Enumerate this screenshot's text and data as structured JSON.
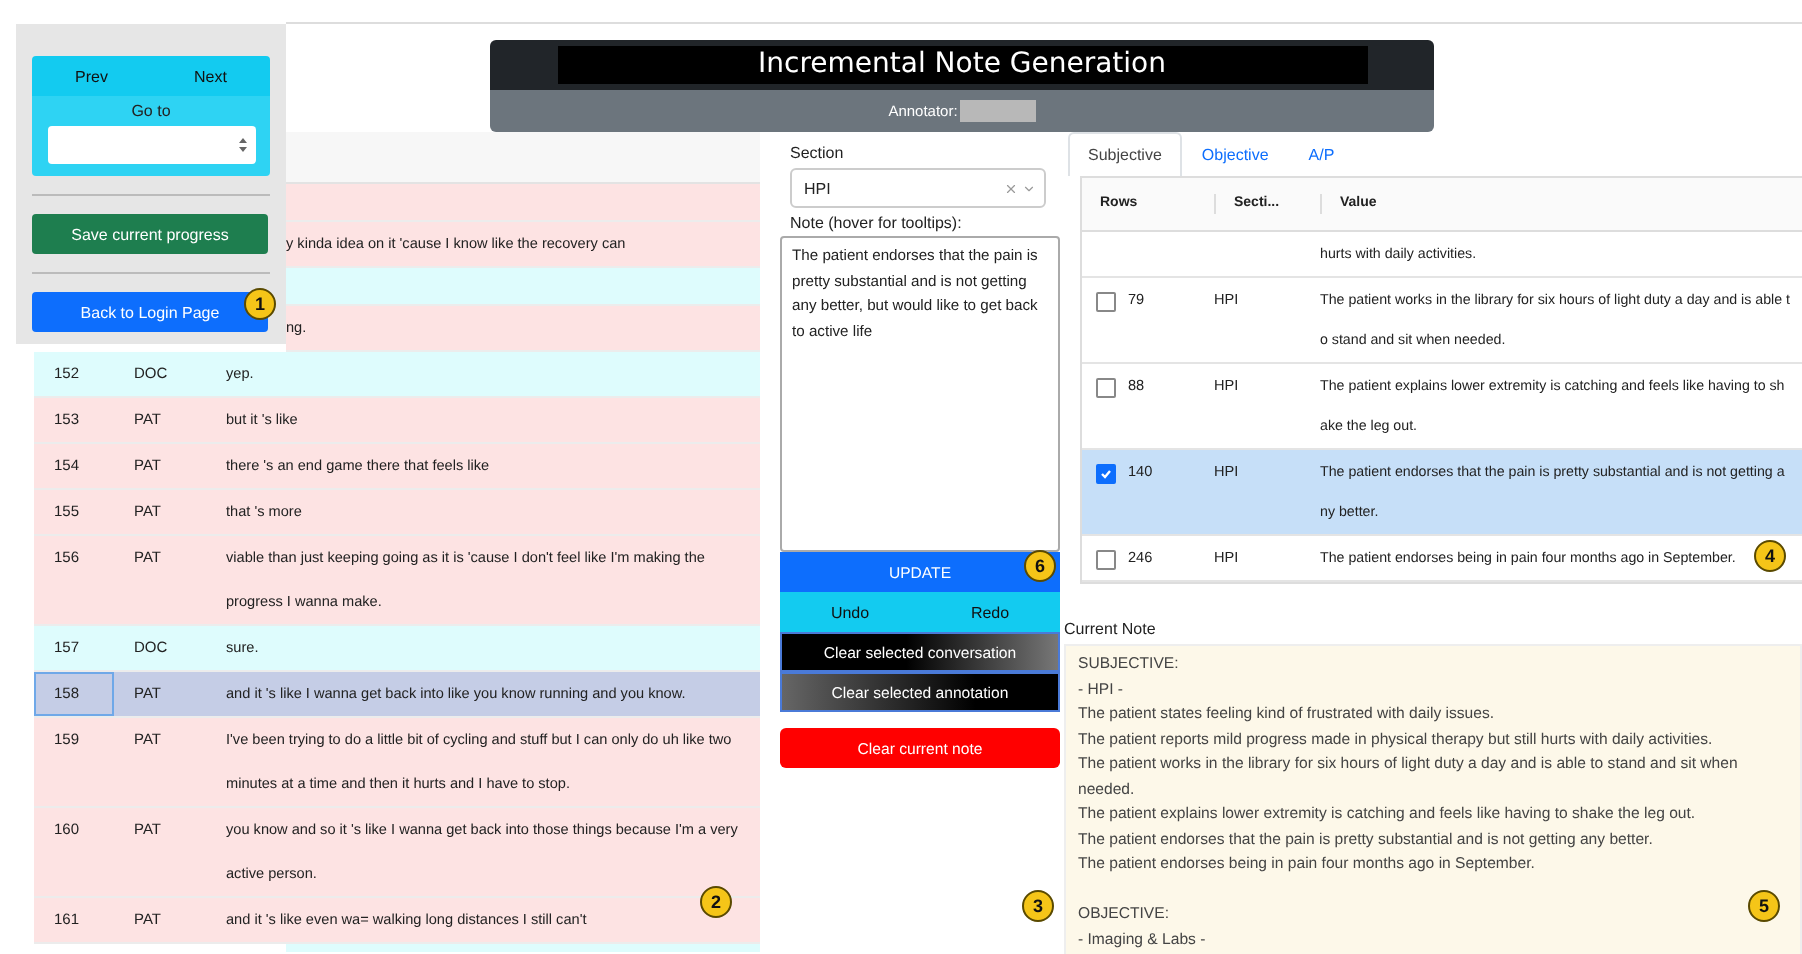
{
  "header": {
    "title": "Incremental Note Generation",
    "annotator_label": "Annotator:"
  },
  "nav_panel": {
    "prev": "Prev",
    "next": "Next",
    "goto_label": "Go to",
    "save": "Save current progress",
    "back": "Back to Login Page"
  },
  "conversation": {
    "rows": [
      {
        "kind": "pat",
        "selected": false
      },
      {
        "kind": "pat",
        "selected": false,
        "text": "y kinda idea on it 'cause I know like the recovery can"
      },
      {
        "kind": "doc",
        "selected": false
      },
      {
        "kind": "pat",
        "selected": false,
        "text": "ng."
      },
      {
        "kind": "doc",
        "selected": false,
        "num": "152",
        "speaker": "DOC",
        "text": "yep."
      },
      {
        "kind": "pat",
        "selected": false,
        "num": "153",
        "speaker": "PAT",
        "text": "but it 's like"
      },
      {
        "kind": "pat",
        "selected": false,
        "num": "154",
        "speaker": "PAT",
        "text": "there 's an end game there that feels like"
      },
      {
        "kind": "pat",
        "selected": false,
        "num": "155",
        "speaker": "PAT",
        "text": "that 's more"
      },
      {
        "kind": "pat",
        "selected": false,
        "num": "156",
        "speaker": "PAT",
        "text": "viable than just keeping going as it is 'cause I don't feel like I'm making the progress I wanna make."
      },
      {
        "kind": "doc",
        "selected": false,
        "num": "157",
        "speaker": "DOC",
        "text": "sure."
      },
      {
        "kind": "pat",
        "selected": true,
        "num": "158",
        "speaker": "PAT",
        "text": "and it 's like I wanna get back into like you know running and you know."
      },
      {
        "kind": "pat",
        "selected": false,
        "num": "159",
        "speaker": "PAT",
        "text": "I've been trying to do a little bit of cycling and stuff but I can only do uh like two minutes at a time and then it hurts and I have to stop."
      },
      {
        "kind": "pat",
        "selected": false,
        "num": "160",
        "speaker": "PAT",
        "text": "you know and so it 's like I wanna get back into those things because I'm a very active person."
      },
      {
        "kind": "pat",
        "selected": false,
        "num": "161",
        "speaker": "PAT",
        "text": "and it 's like even wa= walking long distances I still can't"
      },
      {
        "kind": "doc",
        "selected": false
      }
    ]
  },
  "editor": {
    "section_label": "Section",
    "section_value": "HPI",
    "note_label": "Note (hover for tooltips):",
    "note_value": "The patient endorses that the pain is pretty substantial and is not getting any better, but would like to get back to active life",
    "buttons": [
      {
        "kind": "primary",
        "label": "UPDATE"
      },
      {
        "kind": "split",
        "labels": [
          "Undo",
          "Redo"
        ]
      },
      {
        "kind": "dark",
        "label": "Clear selected conversation"
      },
      {
        "kind": "grey",
        "label": "Clear selected annotation"
      },
      {
        "kind": "danger",
        "label": "Clear current note"
      }
    ]
  },
  "tabs": [
    {
      "label": "Subjective",
      "selected": true
    },
    {
      "label": "Objective",
      "selected": false
    },
    {
      "label": "A/P",
      "selected": false
    }
  ],
  "annotations": {
    "columns": [
      "Rows",
      "Secti...",
      "Value"
    ],
    "rows": [
      {
        "value": "hurts with daily activities."
      },
      {
        "num": "79",
        "section": "HPI",
        "value": "The patient works in the library for six hours of light duty a day and is able to stand and sit when needed.",
        "checked": false
      },
      {
        "num": "88",
        "section": "HPI",
        "value": "The patient explains lower extremity is catching and feels like having to shake the leg out.",
        "checked": false
      },
      {
        "num": "140",
        "section": "HPI",
        "value": "The patient endorses that the pain is pretty substantial and is not getting any better.",
        "checked": true
      },
      {
        "num": "246",
        "section": "HPI",
        "value": "The patient endorses being in pain four months ago in September.",
        "checked": false
      }
    ]
  },
  "current_note": {
    "label": "Current Note",
    "sections": [
      {
        "heading": "SUBJECTIVE:",
        "lines": [
          "- HPI -",
          "The patient states feeling kind of frustrated with daily issues.",
          "The patient reports mild progress made in physical therapy but still hurts with daily activities.",
          "The patient works in the library for six hours of light duty a day and is able to stand and sit when needed.",
          "The patient explains lower extremity is catching and feels like having to shake the leg out.",
          "The patient endorses that the pain is pretty substantial and is not getting any better.",
          "The patient endorses being in pain four months ago in September."
        ]
      },
      {
        "heading": "OBJECTIVE:",
        "lines": [
          "- Imaging & Labs -"
        ]
      }
    ]
  },
  "callouts": [
    "1",
    "2",
    "3",
    "4",
    "5",
    "6"
  ]
}
